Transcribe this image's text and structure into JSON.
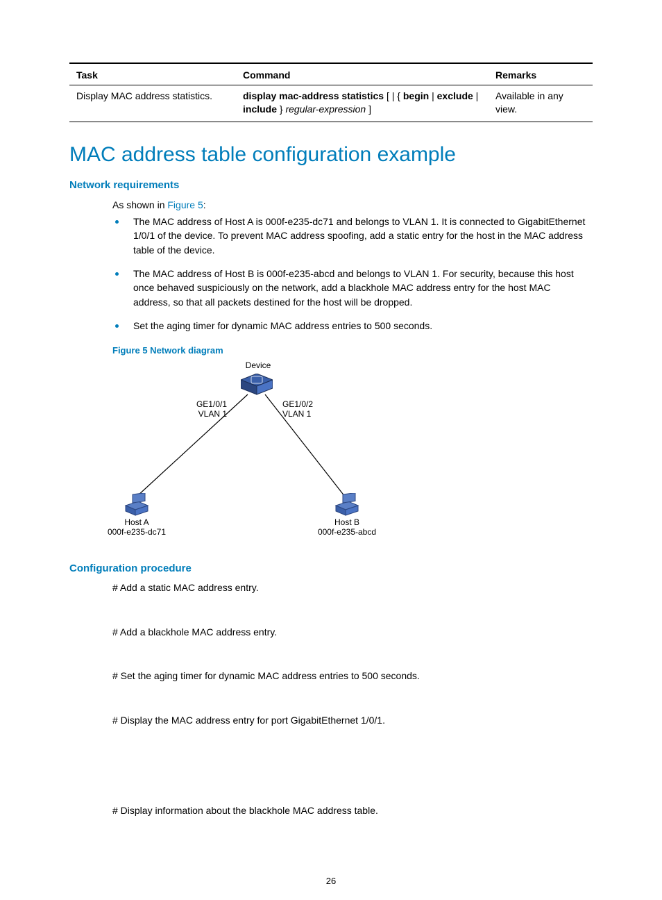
{
  "table": {
    "headers": {
      "c1": "Task",
      "c2": "Command",
      "c3": "Remarks"
    },
    "row": {
      "task": "Display MAC address statistics.",
      "cmd_pre": "display mac-address statistics",
      "cmd_mid1": " [ | { ",
      "cmd_b1": "begin",
      "cmd_sep1": " | ",
      "cmd_b2": "exclude",
      "cmd_sep2": " | ",
      "cmd_b3": "include",
      "cmd_mid2": " } ",
      "cmd_it": "regular-expression",
      "cmd_end": " ]",
      "remarks": "Available in any view."
    }
  },
  "heading": "MAC address table configuration example",
  "sec_req": "Network requirements",
  "req_pre": "As shown in ",
  "req_link": "Figure 5",
  "req_post": ":",
  "bullets": {
    "b1": "The MAC address of Host A is 000f-e235-dc71 and belongs to VLAN 1. It is connected to GigabitEthernet 1/0/1 of the device. To prevent MAC address spoofing, add a static entry for the host in the MAC address table of the device.",
    "b2": "The MAC address of Host B is 000f-e235-abcd and belongs to VLAN 1. For security, because this host once behaved suspiciously on the network, add a blackhole MAC address entry for the host MAC address, so that all packets destined for the host will be dropped.",
    "b3": "Set the aging timer for dynamic MAC address entries to 500 seconds."
  },
  "fig_caption": "Figure 5 Network diagram",
  "fig": {
    "device": "Device",
    "ge1": "GE1/0/1",
    "vlan1": "VLAN 1",
    "ge2": "GE1/0/2",
    "vlan2": "VLAN 1",
    "hosta": "Host A",
    "maca": "000f-e235-dc71",
    "hostb": "Host B",
    "macb": "000f-e235-abcd"
  },
  "sec_proc": "Configuration procedure",
  "proc": {
    "s1": "# Add a static MAC address entry.",
    "s2": "# Add a blackhole MAC address entry.",
    "s3": "# Set the aging timer for dynamic MAC address entries to 500 seconds.",
    "s4": "# Display the MAC address entry for port GigabitEthernet 1/0/1.",
    "s5": "# Display information about the blackhole MAC address table."
  },
  "page_num": "26"
}
